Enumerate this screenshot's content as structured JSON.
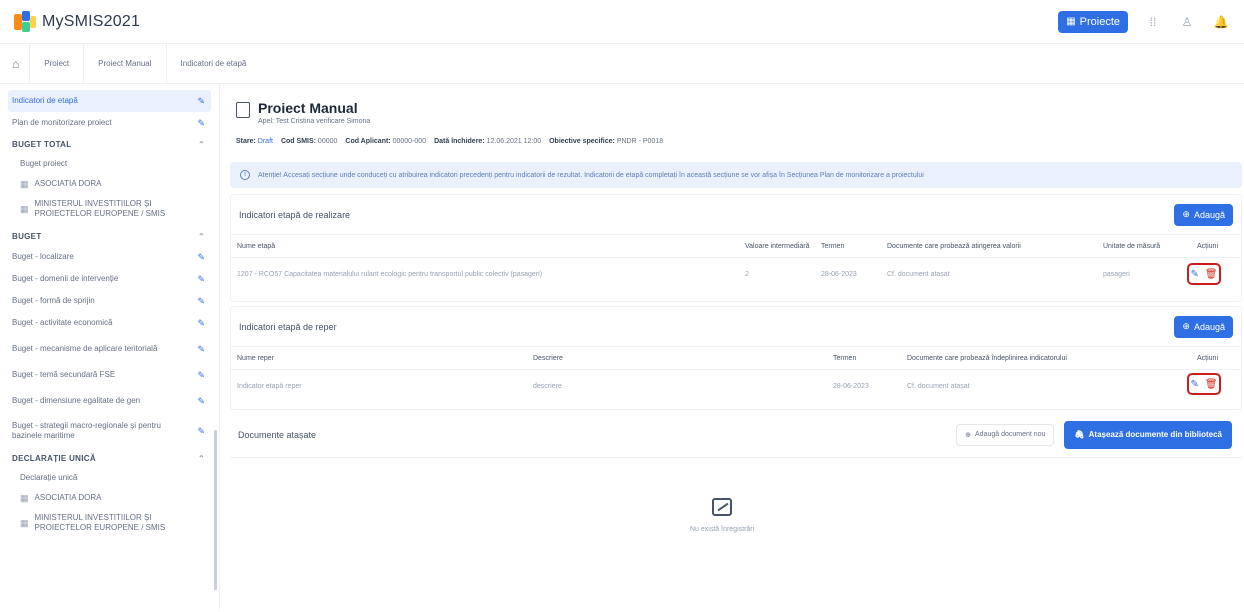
{
  "app": {
    "name": "MySMIS2021"
  },
  "header": {
    "project_button": "Proiecte"
  },
  "breadcrumb": {
    "items": [
      "Proiect",
      "Proiect Manual",
      "Indicatori de etapă"
    ]
  },
  "sidebar": {
    "items_top": [
      {
        "label": "Indicatori de etapă",
        "active": true
      },
      {
        "label": "Plan de monitorizare proiect",
        "active": false
      }
    ],
    "buget_total": {
      "heading": "BUGET TOTAL",
      "sub": [
        "Buget proiect",
        "ASOCIATIA DORA",
        "MINISTERUL INVESTITIILOR ȘI PROIECTELOR EUROPENE / SMIS"
      ]
    },
    "buget": {
      "heading": "BUGET",
      "items": [
        "Buget - localizare",
        "Buget - domenii de intervenție",
        "Buget - formă de sprijin",
        "Buget - activitate economică",
        "Buget - mecanisme de aplicare teritorială",
        "Buget - temă secundară FSE",
        "Buget - dimensiune egalitate de gen",
        "Buget - strategii macro-regionale și pentru bazinele maritime"
      ]
    },
    "declaratie": {
      "heading": "DECLARAȚIE UNICĂ",
      "sub": [
        "Declarație unică",
        "ASOCIATIA DORA",
        "MINISTERUL INVESTITIILOR ȘI PROIECTELOR EUROPENE / SMIS"
      ]
    }
  },
  "project": {
    "title": "Proiect Manual",
    "subtitle": "Apel: Test Cristina verificare Simona",
    "meta": {
      "stare_label": "Stare:",
      "stare_value": "Draft",
      "cod_smis_label": "Cod SMIS:",
      "cod_smis_value": "00000",
      "cod_aplicant_label": "Cod Aplicant:",
      "cod_aplicant_value": "00000-000",
      "data_label": "Dată închidere:",
      "data_value": "12.06.2021 12:00",
      "obiectiv_label": "Obiective specifice:",
      "obiectiv_value": "PNDR - P0018"
    }
  },
  "alert": {
    "text": "Atenție! Accesați secțiune unde conduceți cu atribuirea indicatori precedenți pentru indicatorii de rezultat. Indicatorii de etapă completați în această secțiune se vor afișa în Secțiunea Plan de monitorizare a proiectului"
  },
  "realizare": {
    "title": "Indicatori etapă de realizare",
    "add": "Adaugă",
    "columns": [
      "Nume etapă",
      "Valoare intermediară",
      "Termen",
      "Documente care probează atingerea valorii",
      "Unitate de măsură",
      "Acțiuni"
    ],
    "rows": [
      {
        "name": "1207 - RCO57 Capacitatea materialului rulant ecologic pentru transportul public colectiv (pasageri)",
        "value": "2",
        "termen": "28-06-2023",
        "docs": "Cf. document atașat",
        "unit": "pasageri"
      }
    ]
  },
  "reper": {
    "title": "Indicatori etapă de reper",
    "add": "Adaugă",
    "columns": [
      "Nume reper",
      "Descriere",
      "Termen",
      "Documente care probează îndeplinirea indicatorului",
      "Acțiuni"
    ],
    "rows": [
      {
        "name": "Indicator etapă reper",
        "desc": "descriere",
        "termen": "28-06-2023",
        "docs": "Cf. document atașat"
      }
    ]
  },
  "documents": {
    "title": "Documente atașate",
    "add_new": "Adaugă document nou",
    "attach_library": "Atașează documente din bibliotecă",
    "empty_text": "Nu există înregistrări"
  },
  "colors": {
    "accent": "#2f6fe4",
    "danger": "#d92d20",
    "highlight": "#c81e1e"
  }
}
